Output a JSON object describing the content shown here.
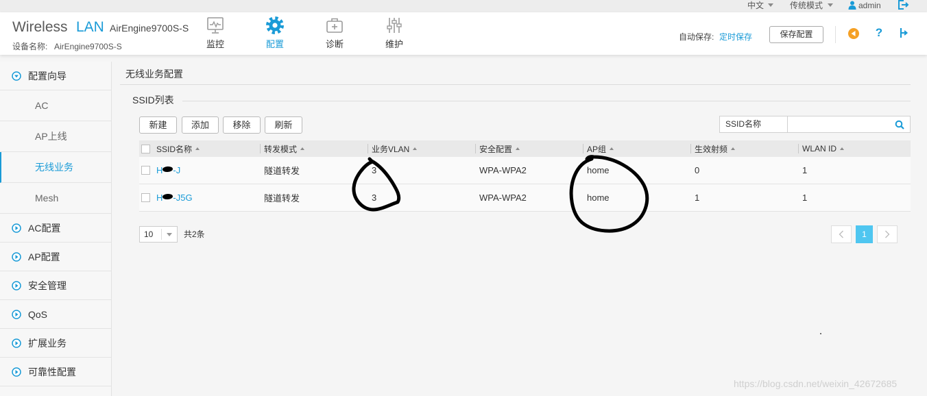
{
  "topbar": {
    "language": "中文",
    "mode": "传统模式",
    "user": "admin",
    "icons": {
      "dropdown": "caret-down-icon",
      "user": "user-icon",
      "logout": "logout-icon"
    }
  },
  "header": {
    "brand_wireless": "Wireless",
    "brand_lan": "LAN",
    "model": "AirEngine9700S-S",
    "device_label": "设备名称:",
    "device_name": "AirEngine9700S-S",
    "nav": [
      {
        "label": "监控",
        "icon": "monitor-icon",
        "active": false
      },
      {
        "label": "配置",
        "icon": "gear-icon",
        "active": true
      },
      {
        "label": "诊断",
        "icon": "first-aid-kit-icon",
        "active": false
      },
      {
        "label": "维护",
        "icon": "sliders-icon",
        "active": false
      }
    ],
    "autosave_label": "自动保存:",
    "autosave_value": "定时保存",
    "save_button": "保存配置",
    "help": "?",
    "right_icons": [
      "back-circle-icon",
      "help-icon",
      "branch-icon"
    ]
  },
  "sidebar": {
    "items": [
      {
        "label": "配置向导",
        "type": "group",
        "expanded": true,
        "icon": "circle-caret-down-icon"
      },
      {
        "label": "AC",
        "type": "sub"
      },
      {
        "label": "AP上线",
        "type": "sub"
      },
      {
        "label": "无线业务",
        "type": "sub",
        "active": true
      },
      {
        "label": "Mesh",
        "type": "sub"
      },
      {
        "label": "AC配置",
        "type": "group",
        "expanded": false,
        "icon": "circle-caret-right-icon"
      },
      {
        "label": "AP配置",
        "type": "group",
        "expanded": false,
        "icon": "circle-caret-right-icon"
      },
      {
        "label": "安全管理",
        "type": "group",
        "expanded": false,
        "icon": "circle-caret-right-icon"
      },
      {
        "label": "QoS",
        "type": "group",
        "expanded": false,
        "icon": "circle-caret-right-icon"
      },
      {
        "label": "扩展业务",
        "type": "group",
        "expanded": false,
        "icon": "circle-caret-right-icon"
      },
      {
        "label": "可靠性配置",
        "type": "group",
        "expanded": false,
        "icon": "circle-caret-right-icon"
      }
    ]
  },
  "main": {
    "page_title": "无线业务配置",
    "section_title": "SSID列表",
    "toolbar": {
      "new": "新建",
      "add": "添加",
      "remove": "移除",
      "refresh": "刷新"
    },
    "search": {
      "label": "SSID名称",
      "value": "",
      "icon": "search-icon"
    },
    "table": {
      "columns": [
        "SSID名称",
        "转发模式",
        "业务VLAN",
        "安全配置",
        "AP组",
        "生效射频",
        "WLAN ID"
      ],
      "sort_icon": "sort-asc-icon",
      "rows": [
        {
          "ssid_prefix": "H",
          "ssid_suffix": "-J",
          "forward_mode": "隧道转发",
          "vlan": "3",
          "security": "WPA-WPA2",
          "ap_group": "home",
          "radio": "0",
          "wlan_id": "1"
        },
        {
          "ssid_prefix": "H",
          "ssid_suffix": "-J5G",
          "forward_mode": "隧道转发",
          "vlan": "3",
          "security": "WPA-WPA2",
          "ap_group": "home",
          "radio": "1",
          "wlan_id": "1"
        }
      ]
    },
    "pagination": {
      "page_size": "10",
      "total": "共2条",
      "current_page": "1",
      "prev_icon": "chevron-left-icon",
      "next_icon": "chevron-right-icon"
    }
  },
  "watermark": "https://blog.csdn.net/weixin_42672685",
  "colors": {
    "accent": "#1a9bd7",
    "active_page": "#4fc6f0",
    "alert": "#f5a024",
    "annotation_ink": "#000000"
  }
}
